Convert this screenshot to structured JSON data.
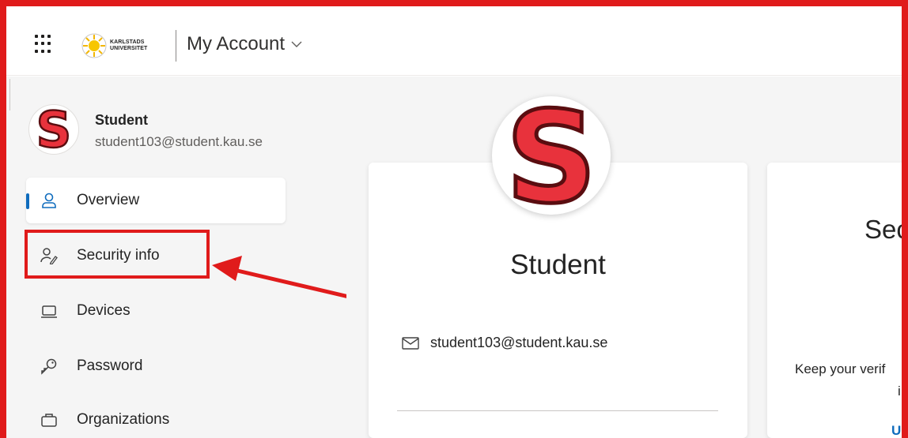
{
  "header": {
    "app_title": "My Account",
    "logo_line1": "KARLSTADS",
    "logo_line2": "UNIVERSITET"
  },
  "user": {
    "initial": "S",
    "name": "Student",
    "email": "student103@student.kau.se"
  },
  "nav": {
    "items": [
      {
        "label": "Overview",
        "icon": "person-icon",
        "active": true
      },
      {
        "label": "Security info",
        "icon": "person-key-icon",
        "active": false,
        "highlighted": true
      },
      {
        "label": "Devices",
        "icon": "laptop-icon",
        "active": false
      },
      {
        "label": "Password",
        "icon": "key-icon",
        "active": false
      },
      {
        "label": "Organizations",
        "icon": "briefcase-icon",
        "active": false
      }
    ]
  },
  "profile_card": {
    "name": "Student",
    "email": "student103@student.kau.se"
  },
  "security_card": {
    "title_partial": "Sec",
    "text_partial": "Keep your verif",
    "text_partial2": "i",
    "link_partial": "UI"
  },
  "colors": {
    "accent": "#0f6cbd",
    "annotation_red": "#e01b1b",
    "avatar_red": "#e8323c"
  }
}
